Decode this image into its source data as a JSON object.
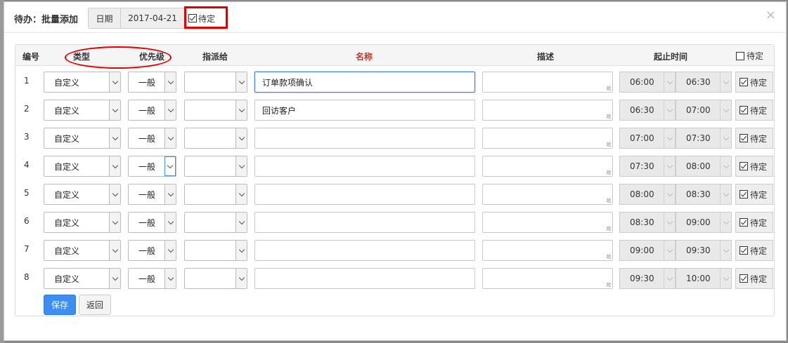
{
  "dialog": {
    "title": "待办：批量添加",
    "date_label": "日期",
    "date_value": "2017-04-21",
    "pending_label": "待定",
    "pending_checked": true,
    "close_glyph": "×"
  },
  "table": {
    "headers": {
      "num": "编号",
      "type": "类型",
      "priority": "优先级",
      "assignee": "指派给",
      "name": "名称",
      "desc": "描述",
      "time": "起止时间",
      "pending": "待定"
    },
    "header_pending_checked": false,
    "rows": [
      {
        "num": "1",
        "type": "自定义",
        "priority": "一般",
        "assignee": "",
        "name": "订单款项确认",
        "desc": "",
        "start": "06:00",
        "end": "06:30",
        "pending": "待定",
        "pending_checked": true
      },
      {
        "num": "2",
        "type": "自定义",
        "priority": "一般",
        "assignee": "",
        "name": "回访客户",
        "desc": "",
        "start": "06:30",
        "end": "07:00",
        "pending": "待定",
        "pending_checked": true
      },
      {
        "num": "3",
        "type": "自定义",
        "priority": "一般",
        "assignee": "",
        "name": "",
        "desc": "",
        "start": "07:00",
        "end": "07:30",
        "pending": "待定",
        "pending_checked": true
      },
      {
        "num": "4",
        "type": "自定义",
        "priority": "一般",
        "assignee": "",
        "name": "",
        "desc": "",
        "start": "07:30",
        "end": "08:00",
        "pending": "待定",
        "pending_checked": true
      },
      {
        "num": "5",
        "type": "自定义",
        "priority": "一般",
        "assignee": "",
        "name": "",
        "desc": "",
        "start": "08:00",
        "end": "08:30",
        "pending": "待定",
        "pending_checked": true
      },
      {
        "num": "6",
        "type": "自定义",
        "priority": "一般",
        "assignee": "",
        "name": "",
        "desc": "",
        "start": "08:30",
        "end": "09:00",
        "pending": "待定",
        "pending_checked": true
      },
      {
        "num": "7",
        "type": "自定义",
        "priority": "一般",
        "assignee": "",
        "name": "",
        "desc": "",
        "start": "09:00",
        "end": "09:30",
        "pending": "待定",
        "pending_checked": true
      },
      {
        "num": "8",
        "type": "自定义",
        "priority": "一般",
        "assignee": "",
        "name": "",
        "desc": "",
        "start": "09:30",
        "end": "10:00",
        "pending": "待定",
        "pending_checked": true
      }
    ]
  },
  "actions": {
    "save_label": "保存",
    "back_label": "返回"
  },
  "colors": {
    "primary": "#3d8ef0",
    "name_header": "#c0392b",
    "annotation": "#e00000"
  },
  "icons": {
    "close": "close-icon",
    "dropdown": "chevron-down-icon",
    "checkbox": "checkbox-icon",
    "resize": "resize-grip-icon"
  }
}
